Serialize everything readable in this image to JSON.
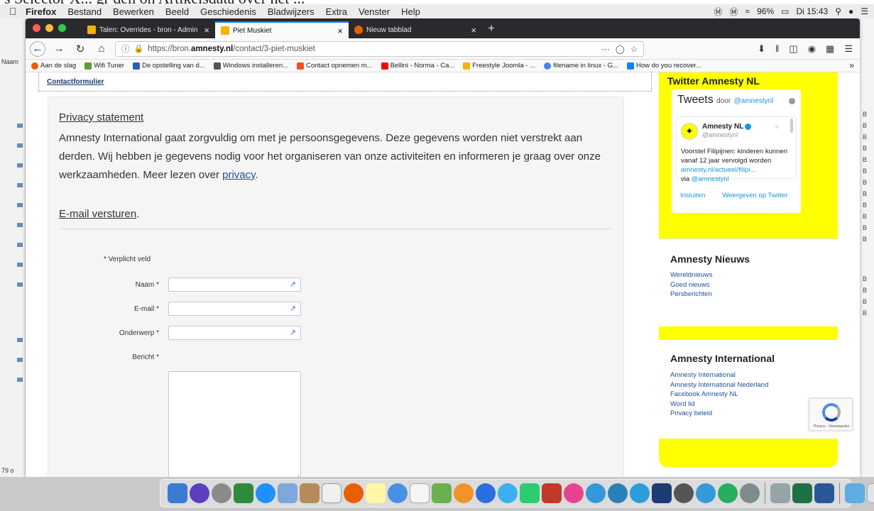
{
  "caption": "s Selector X... gr den on Artikelsdata over het ...",
  "menubar": {
    "items": [
      "Firefox",
      "Bestand",
      "Bewerken",
      "Beeld",
      "Geschiedenis",
      "Bladwijzers",
      "Extra",
      "Venster",
      "Help"
    ],
    "battery": "96%",
    "clock": "Di 15:43"
  },
  "bg_app": {
    "label_top": "Naam",
    "label_bottom": "79 o"
  },
  "tabs": [
    {
      "title": "Talen: Overrides - bron - Admin"
    },
    {
      "title": "Piet Muskiet"
    },
    {
      "title": "Nieuw tabblad"
    }
  ],
  "url": {
    "prefix": "https://bron.",
    "domain": "amnesty.nl",
    "path": "/contact/3-piet-muskiet"
  },
  "bookmarks": [
    {
      "label": "Aan de slag",
      "color": "#e66000"
    },
    {
      "label": "Wifi Tuner",
      "color": "#5aa02c"
    },
    {
      "label": "De opstelling van d...",
      "color": "#2b5fb4"
    },
    {
      "label": "Windows installeren...",
      "color": "#555555"
    },
    {
      "label": "Contact opnemen m...",
      "color": "#f25022"
    },
    {
      "label": "Bellini - Norma - Ca...",
      "color": "#ff0000"
    },
    {
      "label": "Freestyle Joomla - ...",
      "color": "#f4b400"
    },
    {
      "label": "filename in linux - G...",
      "color": "#4285f4"
    },
    {
      "label": "How do you recover...",
      "color": "#0a84ff"
    }
  ],
  "breadcrumb": "Contactformulier",
  "privacy": {
    "title": "Privacy statement",
    "text": "Amnesty International gaat zorgvuldig om met je persoonsgegevens. Deze gegevens worden niet verstrekt aan derden. Wij hebben je gegevens nodig voor het organiseren van onze activiteiten en informeren je graag over onze werkzaamheden. Meer lezen over ",
    "link": "privacy",
    "end": "."
  },
  "email": {
    "title": "E-mail versturen",
    "dot": "."
  },
  "form": {
    "required_note": "* Verplicht veld",
    "name_label": "Naam *",
    "email_label": "E-mail *",
    "subject_label": "Onderwerp *",
    "message_label": "Bericht *"
  },
  "sidebar": {
    "twitter_title": "Twitter Amnesty NL",
    "tweets_label": "Tweets",
    "tweets_by": "door",
    "tweets_handle": "@amnestynl",
    "tweet": {
      "name": "Amnesty NL",
      "handle": "@amnestynl",
      "text": "Voorstel Filipijnen: kinderen kunnen vanaf 12 jaar vervolgd worden ",
      "link": "amnesty.nl/actueel/filipi...",
      "via": "via ",
      "via_handle": "@amnestynl"
    },
    "embed_label": "Insluiten",
    "view_label": "Weergeven op Twitter",
    "news": {
      "title": "Amnesty Nieuws",
      "links": [
        "Wereldnieuws",
        "Goed nieuws",
        "Persberichten"
      ]
    },
    "intl": {
      "title": "Amnesty International",
      "links": [
        "Amnesty International",
        "Amnesty International Nederland",
        "Facebook Amnesty NL",
        "Word lid",
        "Privacy beleid"
      ]
    }
  },
  "recaptcha": "Privacy - Voorwaarden",
  "right_strip_letter": "B"
}
